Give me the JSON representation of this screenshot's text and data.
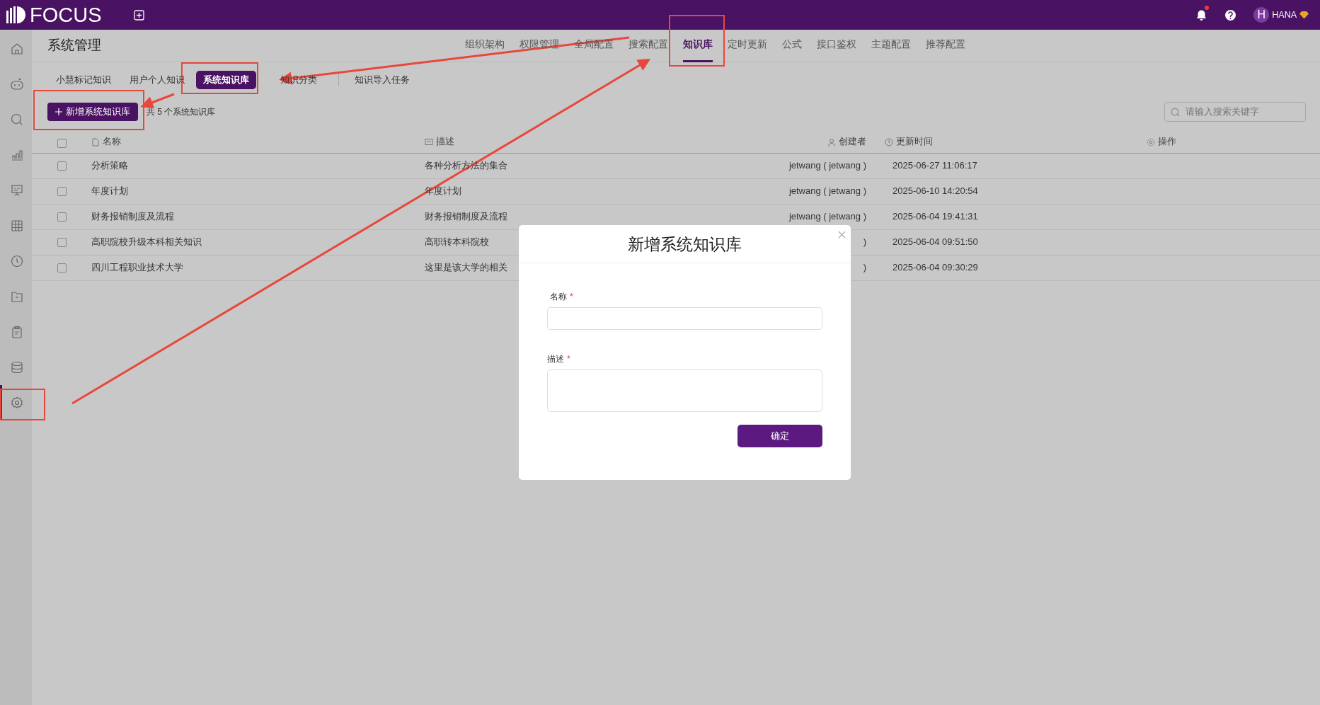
{
  "app": {
    "logo": "FOCUS"
  },
  "topbar": {
    "notifications_unread": true,
    "user_initial": "H",
    "user_name": "HANA"
  },
  "sidebar": {
    "items": [
      {
        "kind": "home",
        "selected": false
      },
      {
        "kind": "robot",
        "selected": false
      },
      {
        "kind": "search",
        "selected": false
      },
      {
        "kind": "chart",
        "selected": false
      },
      {
        "kind": "board",
        "selected": false
      },
      {
        "kind": "grid",
        "selected": false
      },
      {
        "kind": "clock",
        "selected": false
      },
      {
        "kind": "folder",
        "selected": false
      },
      {
        "kind": "clipboard",
        "selected": false
      },
      {
        "kind": "database",
        "selected": false
      },
      {
        "kind": "settings",
        "selected": true
      }
    ]
  },
  "page": {
    "title": "系统管理"
  },
  "nav_tabs": [
    {
      "label": "组织架构",
      "selected": false
    },
    {
      "label": "权限管理",
      "selected": false
    },
    {
      "label": "全局配置",
      "selected": false
    },
    {
      "label": "搜索配置",
      "selected": false
    },
    {
      "label": "知识库",
      "selected": true
    },
    {
      "label": "定时更新",
      "selected": false
    },
    {
      "label": "公式",
      "selected": false
    },
    {
      "label": "接口鉴权",
      "selected": false
    },
    {
      "label": "主题配置",
      "selected": false
    },
    {
      "label": "推荐配置",
      "selected": false
    }
  ],
  "sub_tabs": [
    {
      "label": "小慧标记知识",
      "selected": false
    },
    {
      "label": "用户个人知识",
      "selected": false
    },
    {
      "label": "系统知识库",
      "selected": true
    },
    {
      "label": "知识分类",
      "selected": false
    },
    {
      "label": "知识导入任务",
      "selected": false
    }
  ],
  "toolbar": {
    "add_button": "新增系统知识库",
    "count": "共 5 个系统知识库",
    "search_placeholder": "请输入搜索关键字"
  },
  "table": {
    "select_all": false,
    "columns": [
      {
        "label": "名称"
      },
      {
        "label": "描述"
      },
      {
        "label": "创建者"
      },
      {
        "label": "更新时间"
      },
      {
        "label": "操作"
      }
    ],
    "rows": [
      {
        "checked": false,
        "name": "分析策略",
        "description": "各种分析方法的集合",
        "creator": "jetwang ( jetwang )",
        "updated": "2025-06-27 11:06:17"
      },
      {
        "checked": false,
        "name": "年度计划",
        "description": "年度计划",
        "creator": "jetwang ( jetwang )",
        "updated": "2025-06-10 14:20:54"
      },
      {
        "checked": false,
        "name": "财务报销制度及流程",
        "description": "财务报销制度及流程",
        "creator": "jetwang ( jetwang )",
        "updated": "2025-06-04 19:41:31"
      },
      {
        "checked": false,
        "name": "高职院校升级本科相关知识",
        "description": "高职转本科院校",
        "creator": ")",
        "updated": "2025-06-04 09:51:50"
      },
      {
        "checked": false,
        "name": "四川工程职业技术大学",
        "description": "这里是该大学的相关",
        "creator": ")",
        "updated": "2025-06-04 09:30:29"
      }
    ]
  },
  "modal": {
    "title": "新增系统知识库",
    "fields": [
      {
        "label": "名称",
        "required_mark": "*",
        "kind": "input"
      },
      {
        "label": "描述",
        "required_mark": "*",
        "kind": "textarea"
      }
    ],
    "submit": "确定"
  }
}
